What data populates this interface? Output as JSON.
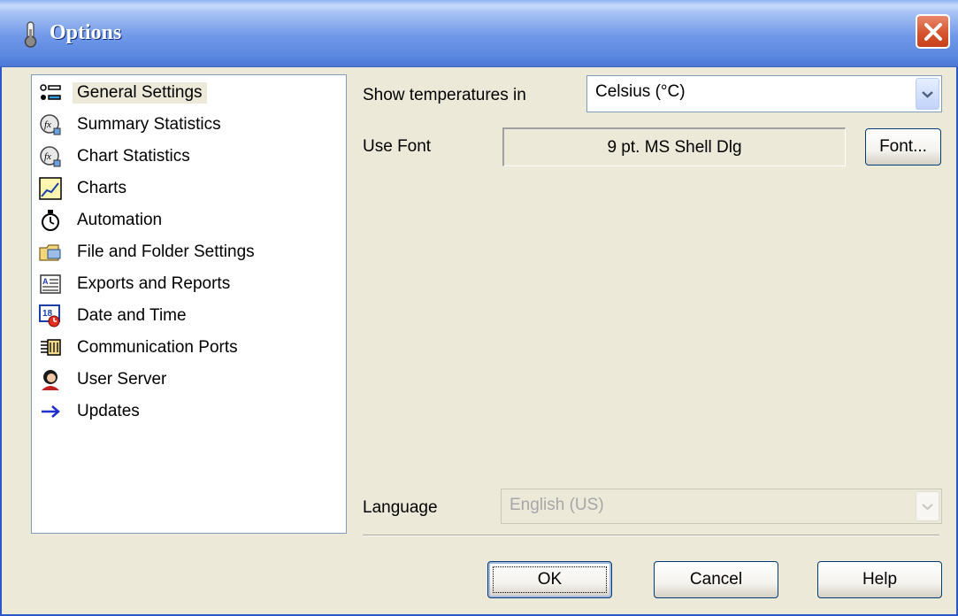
{
  "window": {
    "title": "Options"
  },
  "nav": {
    "items": [
      {
        "label": "General Settings",
        "icon": "general-settings-icon"
      },
      {
        "label": "Summary Statistics",
        "icon": "function-icon"
      },
      {
        "label": "Chart Statistics",
        "icon": "function-icon"
      },
      {
        "label": "Charts",
        "icon": "line-chart-icon"
      },
      {
        "label": "Automation",
        "icon": "stopwatch-icon"
      },
      {
        "label": "File and Folder Settings",
        "icon": "folder-icon"
      },
      {
        "label": "Exports and Reports",
        "icon": "report-icon"
      },
      {
        "label": "Date and Time",
        "icon": "calendar-clock-icon"
      },
      {
        "label": "Communication Ports",
        "icon": "port-icon"
      },
      {
        "label": "User Server",
        "icon": "user-icon"
      },
      {
        "label": "Updates",
        "icon": "arrow-right-icon"
      }
    ]
  },
  "general": {
    "temp_label": "Show temperatures in",
    "temp_value": "Celsius (°C)",
    "font_label": "Use Font",
    "font_value": "9 pt. MS Shell Dlg",
    "font_button": "Font...",
    "language_label": "Language",
    "language_value": "English (US)"
  },
  "footer": {
    "ok": "OK",
    "cancel": "Cancel",
    "help": "Help"
  },
  "colors": {
    "title_blue": "#5a87e0",
    "close_red": "#d5552f",
    "dialog_bg": "#ece9d8",
    "border": "#7f9db9"
  }
}
